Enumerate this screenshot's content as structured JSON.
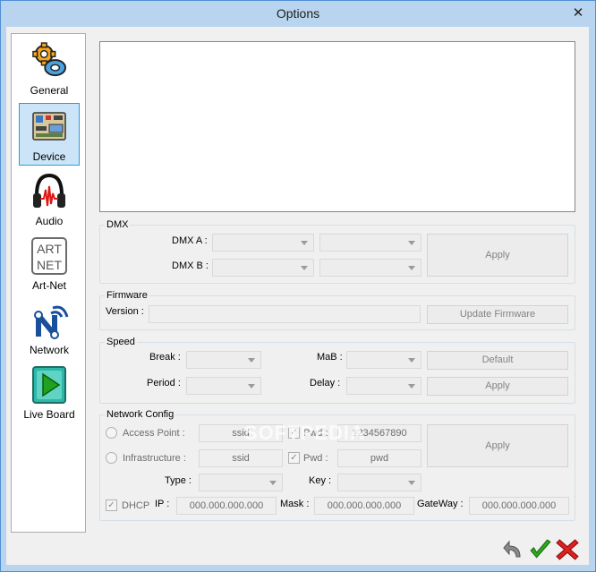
{
  "window": {
    "title": "Options",
    "close_glyph": "✕"
  },
  "sidebar": {
    "items": [
      {
        "label": "General",
        "icon": "gears-icon",
        "selected": false
      },
      {
        "label": "Device",
        "icon": "circuit-board-icon",
        "selected": true
      },
      {
        "label": "Audio",
        "icon": "headphones-icon",
        "selected": false
      },
      {
        "label": "Art-Net",
        "icon": "artnet-logo-icon",
        "selected": false
      },
      {
        "label": "Network",
        "icon": "network-n-icon",
        "selected": false
      },
      {
        "label": "Live Board",
        "icon": "play-board-icon",
        "selected": false
      }
    ]
  },
  "dmx": {
    "title": "DMX",
    "dmx_a_label": "DMX A :",
    "dmx_b_label": "DMX B :",
    "apply": "Apply"
  },
  "firmware": {
    "title": "Firmware",
    "version_label": "Version :",
    "update": "Update Firmware"
  },
  "speed": {
    "title": "Speed",
    "break_label": "Break :",
    "period_label": "Period :",
    "mab_label": "MaB :",
    "delay_label": "Delay :",
    "default": "Default",
    "apply": "Apply"
  },
  "network": {
    "title": "Network Config",
    "access_point": "Access Point :",
    "infrastructure": "Infrastructure :",
    "ssid_1": "ssid",
    "ssid_2": "ssid",
    "pwd_label_1": "Pwd :",
    "pwd_label_2": "Pwd :",
    "pwd_value_1": "1234567890",
    "pwd_value_2": "pwd",
    "type_label": "Type :",
    "key_label": "Key :",
    "apply": "Apply",
    "dhcp": "DHCP",
    "ip_label": "IP :",
    "ip_value": "000.000.000.000",
    "mask_label": "Mask :",
    "mask_value": "000.000.000.000",
    "gateway_label": "GateWay :",
    "gateway_value": "000.000.000.000"
  },
  "watermark": "SOFTPEDIA",
  "check_glyph": "✓",
  "colors": {
    "accent": "#26a0da",
    "ok": "#2eaa1e",
    "cancel": "#e02020",
    "title_bar": "#b9d4ef"
  }
}
